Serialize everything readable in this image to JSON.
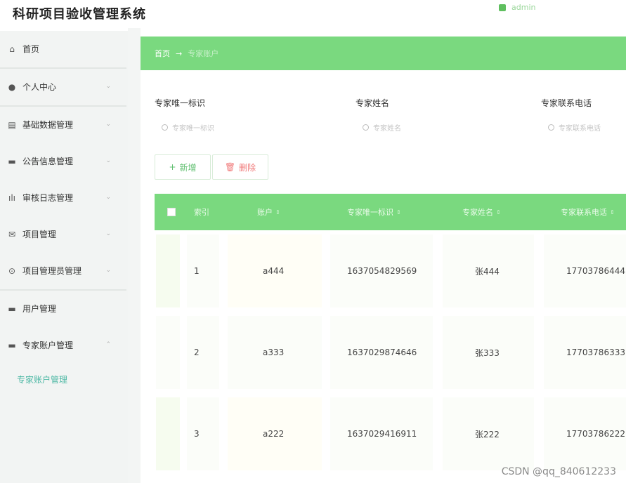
{
  "app": {
    "title": "科研项目验收管理系统",
    "user_label": "admin"
  },
  "sidebar": {
    "items": [
      {
        "label": "首页",
        "icon": "home-icon",
        "glyph": "⌂",
        "has_children": false
      },
      {
        "label": "个人中心",
        "icon": "user-icon",
        "glyph": "👤",
        "has_children": true
      },
      {
        "label": "基础数据管理",
        "icon": "database-icon",
        "glyph": "▤",
        "has_children": true
      },
      {
        "label": "公告信息管理",
        "icon": "notice-icon",
        "glyph": "▬",
        "has_children": true
      },
      {
        "label": "审核日志管理",
        "icon": "chart-icon",
        "glyph": "▮",
        "has_children": true
      },
      {
        "label": "项目管理",
        "icon": "mail-icon",
        "glyph": "✉",
        "has_children": true
      },
      {
        "label": "项目管理员管理",
        "icon": "help-icon",
        "glyph": "⊙",
        "has_children": true
      },
      {
        "label": "用户管理",
        "icon": "user-list-icon",
        "glyph": "▬",
        "has_children": false
      },
      {
        "label": "专家账户管理",
        "icon": "expert-icon",
        "glyph": "▬",
        "has_children": true
      }
    ],
    "active_sub": "专家账户管理"
  },
  "breadcrumb": {
    "home": "首页",
    "separator": "→",
    "current": "专家账户"
  },
  "search": {
    "fields": [
      {
        "label": "专家唯一标识",
        "placeholder": "专家唯一标识"
      },
      {
        "label": "专家姓名",
        "placeholder": "专家姓名"
      },
      {
        "label": "专家联系电话",
        "placeholder": "专家联系电话"
      }
    ]
  },
  "toolbar": {
    "add_label": "新增",
    "delete_label": "删除"
  },
  "table": {
    "columns": [
      "索引",
      "账户",
      "专家唯一标识",
      "专家姓名",
      "专家联系电话"
    ],
    "rows": [
      {
        "index": "1",
        "account": "a444",
        "id": "1637054829569",
        "name": "张444",
        "phone": "17703786444"
      },
      {
        "index": "2",
        "account": "a333",
        "id": "1637029874646",
        "name": "张333",
        "phone": "17703786333"
      },
      {
        "index": "3",
        "account": "a222",
        "id": "1637029416911",
        "name": "张222",
        "phone": "17703786222"
      }
    ]
  },
  "watermark": "CSDN @qq_840612233",
  "colors": {
    "accent": "#7ad97f",
    "sub_active": "#4db8a4",
    "delete": "#f07b7b"
  }
}
